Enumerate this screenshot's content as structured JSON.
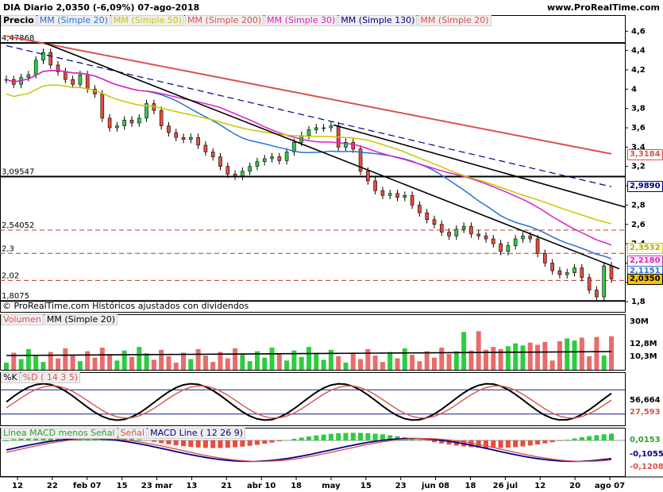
{
  "header": {
    "symbol_line": "DIA   Diario   2,0350 (-6,09%)   07-ago-2018",
    "site": "www.ProRealTime.com"
  },
  "legend_price": [
    {
      "text": "Precio",
      "color": "#000000",
      "bold": true
    },
    {
      "text": "MM (Simple 20)",
      "color": "#2b6fd6"
    },
    {
      "text": "MM (Simple 50)",
      "color": "#c8c800"
    },
    {
      "text": "MM (Simple 200)",
      "color": "#d9534f"
    },
    {
      "text": "MM (Simple 30)",
      "color": "#e020c0"
    },
    {
      "text": "MM (Simple 130)",
      "color": "#00008b"
    },
    {
      "text": "MM (Simple 20)",
      "color": "#d9534f"
    }
  ],
  "legend_volume": [
    {
      "text": "Volumen",
      "color": "#d9534f"
    },
    {
      "text": "MM (Simple 20)",
      "color": "#000000"
    }
  ],
  "legend_stoch": [
    {
      "text": "%K",
      "color": "#000000"
    },
    {
      "text": "%D ( 14 3 5)",
      "color": "#d9534f"
    }
  ],
  "legend_macd": [
    {
      "text": "Línea MACD menos Señal",
      "color": "#2ca02c"
    },
    {
      "text": "Señal",
      "color": "#d9534f"
    },
    {
      "text": "MACD Line ( 12 26 9)",
      "color": "#00008b"
    }
  ],
  "caption": "© ProRealTime.com  Históricos ajustados con dividendos",
  "price_axis": {
    "ticks": [
      "4,6",
      "4,4",
      "4,2",
      "4",
      "3,8",
      "3,6",
      "3,4",
      "3,2",
      "3",
      "2,8",
      "2,6",
      "2,4",
      "2,2",
      "2",
      "1,8"
    ],
    "ymin": 1.76,
    "ymax": 4.66
  },
  "levels": [
    {
      "label": "4,47868",
      "value": 4.47868,
      "style": "solid"
    },
    {
      "label": "3,09547",
      "value": 3.09547,
      "style": "solid"
    },
    {
      "label": "2,54052",
      "value": 2.54052,
      "style": "dashed"
    },
    {
      "label": "2,3",
      "value": 2.3,
      "style": "dashed"
    },
    {
      "label": "2,02",
      "value": 2.02,
      "style": "dashed"
    },
    {
      "label": "1,8075",
      "value": 1.8075,
      "style": "solid"
    }
  ],
  "price_tags": [
    {
      "text": "3,3184",
      "value": 3.3184,
      "bg": "#ffffff",
      "fg": "#d9534f",
      "border": "#d9534f"
    },
    {
      "text": "2,9890",
      "value": 2.989,
      "bg": "#ffffff",
      "fg": "#00008b",
      "border": "#00008b"
    },
    {
      "text": "2,3532",
      "value": 2.3532,
      "bg": "#ffffff",
      "fg": "#b0b000",
      "border": "#c8c800"
    },
    {
      "text": "2,2180",
      "value": 2.218,
      "bg": "#ffffff",
      "fg": "#e020c0",
      "border": "#e020c0"
    },
    {
      "text": "2,1151",
      "value": 2.1151,
      "bg": "#ffffff",
      "fg": "#2b6fd6",
      "border": "#2b6fd6"
    },
    {
      "text": "2,0350",
      "value": 2.035,
      "bg": "#f5c400",
      "fg": "#000000",
      "border": "#000000"
    }
  ],
  "volume_axis": {
    "ticks": [
      "30M",
      "12,8M",
      "10,3M"
    ]
  },
  "stoch_tags": [
    {
      "text": "56,664",
      "value": 56.664,
      "fg": "#000000"
    },
    {
      "text": "27,593",
      "value": 27.593,
      "fg": "#d9534f"
    }
  ],
  "macd_tags": [
    {
      "text": "0,0153",
      "fg": "#2ca02c"
    },
    {
      "text": "-0,1055",
      "fg": "#00008b"
    },
    {
      "text": "-0,1208",
      "fg": "#d9534f"
    }
  ],
  "x_axis": {
    "labels": [
      "12",
      "22",
      "feb 07",
      "15",
      "23 mar",
      "13",
      "21",
      "abr 10",
      "18",
      "may",
      "15",
      "23",
      "jun 08",
      "18",
      "26 jul",
      "12",
      "20",
      "ago 07"
    ]
  },
  "chart_data": {
    "type": "candlestick",
    "closes": [
      4.1,
      4.05,
      4.12,
      4.15,
      4.3,
      4.38,
      4.25,
      4.18,
      4.1,
      4.05,
      4.15,
      4.0,
      3.95,
      3.7,
      3.6,
      3.62,
      3.68,
      3.65,
      3.7,
      3.85,
      3.78,
      3.62,
      3.55,
      3.5,
      3.48,
      3.5,
      3.42,
      3.35,
      3.3,
      3.2,
      3.12,
      3.1,
      3.15,
      3.2,
      3.25,
      3.28,
      3.3,
      3.26,
      3.35,
      3.45,
      3.52,
      3.58,
      3.6,
      3.6,
      3.62,
      3.4,
      3.45,
      3.38,
      3.15,
      3.05,
      2.95,
      2.9,
      2.92,
      2.88,
      2.9,
      2.8,
      2.72,
      2.65,
      2.6,
      2.52,
      2.48,
      2.55,
      2.58,
      2.5,
      2.48,
      2.45,
      2.4,
      2.32,
      2.38,
      2.45,
      2.48,
      2.45,
      2.3,
      2.2,
      2.12,
      2.08,
      2.1,
      2.15,
      2.05,
      1.92,
      1.85,
      2.17,
      2.035
    ]
  }
}
